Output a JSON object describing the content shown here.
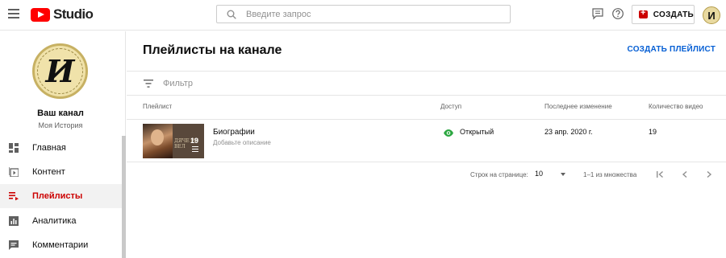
{
  "header": {
    "logo_text": "Studio",
    "search_placeholder": "Введите запрос",
    "create_label": "СОЗДАТЬ",
    "avatar_letter": "И"
  },
  "sidebar": {
    "avatar_letter": "И",
    "channel_name": "Ваш канал",
    "channel_subtitle": "Моя История",
    "items": [
      {
        "label": "Главная",
        "icon": "dashboard-icon"
      },
      {
        "label": "Контент",
        "icon": "content-icon"
      },
      {
        "label": "Плейлисты",
        "icon": "playlists-icon",
        "active": true
      },
      {
        "label": "Аналитика",
        "icon": "analytics-icon"
      },
      {
        "label": "Комментарии",
        "icon": "comments-icon"
      }
    ]
  },
  "main": {
    "title": "Плейлисты на канале",
    "create_playlist_label": "СОЗДАТЬ ПЛЕЙЛИСТ",
    "filter_placeholder": "Фильтр",
    "columns": [
      "Плейлист",
      "Доступ",
      "Последнее изменение",
      "Количество видео"
    ],
    "rows": [
      {
        "title": "Биографии",
        "description": "Добавьте описание",
        "thumb_count": "19",
        "thumb_caption": "ДЯЧЕ РИ ВЕЛ",
        "visibility": "Открытый",
        "updated": "23 апр. 2020 г.",
        "video_count": "19"
      }
    ],
    "pager": {
      "rows_per_page_label": "Строк на странице:",
      "rows_per_page_value": "10",
      "range_text": "1–1 из множества"
    }
  },
  "colors": {
    "brand_red": "#ff0000",
    "active_red": "#cc0000",
    "link_blue": "#065fd4",
    "visibility_green": "#2ba640"
  }
}
